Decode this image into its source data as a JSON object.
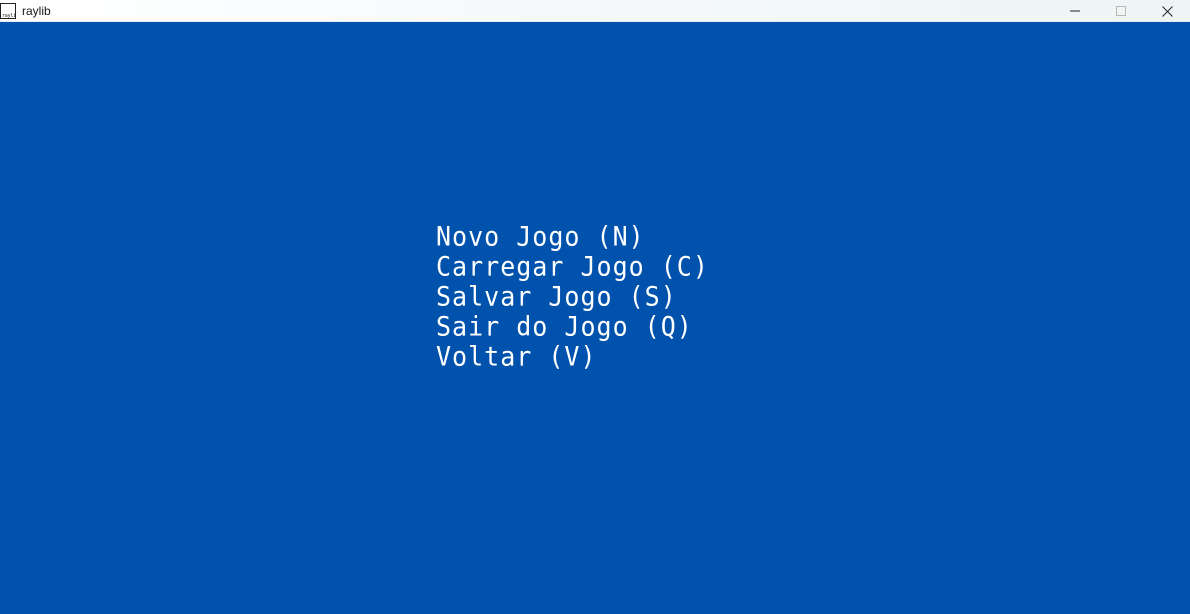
{
  "window": {
    "title": "raylib",
    "icon": "raylib-logo-icon",
    "controls": [
      "minimize-icon",
      "maximize-icon",
      "close-icon"
    ]
  },
  "game": {
    "background_color": "#0052ac",
    "text_color": "#ffffff",
    "menu": [
      {
        "label": "Novo Jogo (N)"
      },
      {
        "label": "Carregar Jogo (C)"
      },
      {
        "label": "Salvar Jogo (S)"
      },
      {
        "label": "Sair do Jogo (Q)"
      },
      {
        "label": "Voltar (V)"
      }
    ]
  }
}
